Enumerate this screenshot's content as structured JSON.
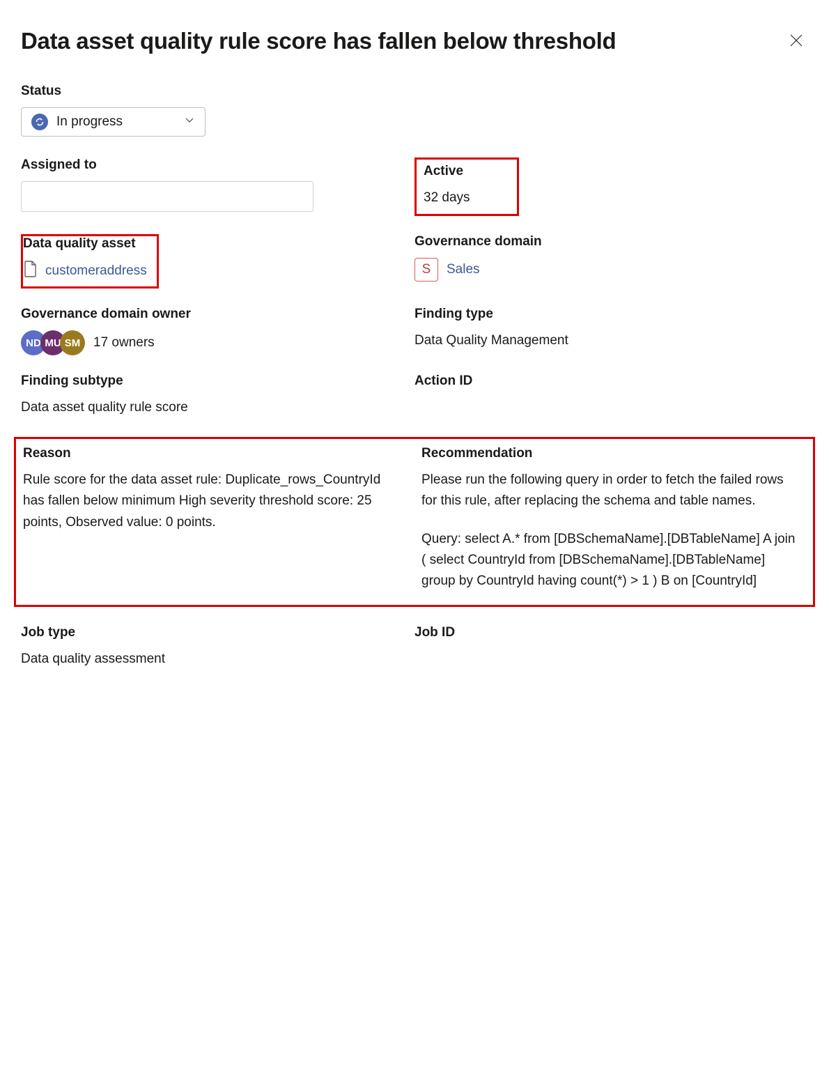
{
  "header": {
    "title": "Data asset quality rule score has fallen below threshold"
  },
  "status": {
    "label": "Status",
    "value": "In progress"
  },
  "assigned_to": {
    "label": "Assigned to",
    "value": ""
  },
  "active": {
    "label": "Active",
    "value": "32 days"
  },
  "dq_asset": {
    "label": "Data quality asset",
    "value": "customeraddress"
  },
  "gov_domain": {
    "label": "Governance domain",
    "badge": "S",
    "value": "Sales"
  },
  "gov_owner": {
    "label": "Governance domain owner",
    "avatars": [
      "ND",
      "MU",
      "SM"
    ],
    "count_text": "17 owners"
  },
  "finding_type": {
    "label": "Finding type",
    "value": "Data Quality Management"
  },
  "finding_subtype": {
    "label": "Finding subtype",
    "value": "Data asset quality rule score"
  },
  "action_id": {
    "label": "Action ID",
    "value": ""
  },
  "reason": {
    "label": "Reason",
    "value": "Rule score for the data asset rule: Duplicate_rows_CountryId has fallen below minimum High severity threshold score: 25 points, Observed value: 0 points."
  },
  "recommendation": {
    "label": "Recommendation",
    "para1": "Please run the following query in order to fetch the failed rows for this rule, after replacing the schema and table names.",
    "para2": "Query: select A.* from [DBSchemaName].[DBTableName] A join ( select CountryId from [DBSchemaName].[DBTableName] group by CountryId having count(*) > 1 ) B on [CountryId]"
  },
  "job_type": {
    "label": "Job type",
    "value": "Data quality assessment"
  },
  "job_id": {
    "label": "Job ID",
    "value": ""
  }
}
